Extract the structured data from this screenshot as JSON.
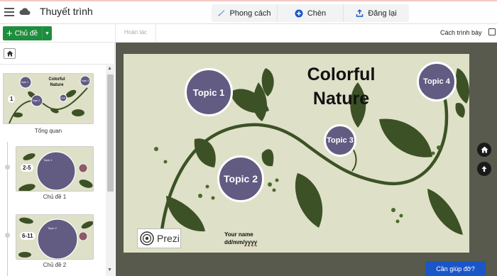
{
  "app": {
    "title": "Thuyết trình"
  },
  "toolbar": {
    "tabs": [
      {
        "label": "Phong cách",
        "icon": "brush-icon"
      },
      {
        "label": "Chèn",
        "icon": "plus-circle-icon"
      },
      {
        "label": "Đăng lại",
        "icon": "share-icon"
      }
    ]
  },
  "actions": {
    "add_topic_label": "Chủ đề",
    "undo_label": "Hoàn tác",
    "present_label": "Cách trình bày"
  },
  "outline": {
    "overview": {
      "caption": "Tổng quan",
      "badge": "1",
      "mini_title": "Colorful Nature",
      "mini_topics": [
        "Topic 1",
        "Topic 2",
        "Topic 3",
        "Topic 4"
      ]
    },
    "chapters": [
      {
        "badge": "2-5",
        "caption": "Chủ đề 1",
        "mini_topic": "Topic 1"
      },
      {
        "badge": "6-11",
        "caption": "Chủ đề 2",
        "mini_topic": "Topic 2"
      }
    ]
  },
  "slide": {
    "title_line1": "Colorful",
    "title_line2": "Nature",
    "topics": [
      "Topic 1",
      "Topic 2",
      "Topic 3",
      "Topic 4"
    ],
    "your_name": "Your name",
    "date_prefix": "dd/mm/",
    "date_suffix": "yyyy",
    "brand": "Prezi"
  },
  "help": {
    "label": "Cần giúp đỡ?"
  },
  "colors": {
    "accent_green": "#1e8e3e",
    "topic_purple": "#625b82",
    "slide_bg": "#dfe0c8",
    "canvas_frame": "#585a4d",
    "leaf_green": "#3c5226",
    "help_blue": "#1a56c7"
  }
}
